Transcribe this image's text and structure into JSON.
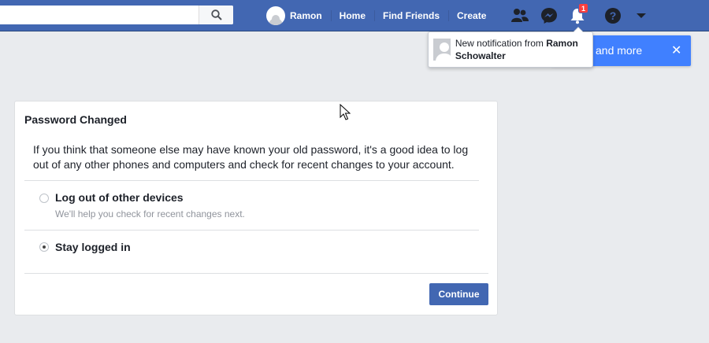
{
  "topbar": {
    "profile_name": "Ramon",
    "nav": [
      "Home",
      "Find Friends",
      "Create"
    ],
    "notification_count": "1"
  },
  "notification": {
    "prefix": "New notification from ",
    "name": "Ramon Schowalter"
  },
  "toast": {
    "text": "and more",
    "close": "✕"
  },
  "dialog": {
    "title": "Password Changed",
    "description": "If you think that someone else may have known your old password, it's a good idea to log out of any other phones and computers and check for recent changes to your account.",
    "options": [
      {
        "label": "Log out of other devices",
        "sublabel": "We'll help you check for recent changes next.",
        "selected": false
      },
      {
        "label": "Stay logged in",
        "sublabel": "",
        "selected": true
      }
    ],
    "continue_label": "Continue"
  },
  "colors": {
    "topbar": "#4267b2",
    "toast": "#4080ff",
    "badge": "#fa3e3e"
  }
}
